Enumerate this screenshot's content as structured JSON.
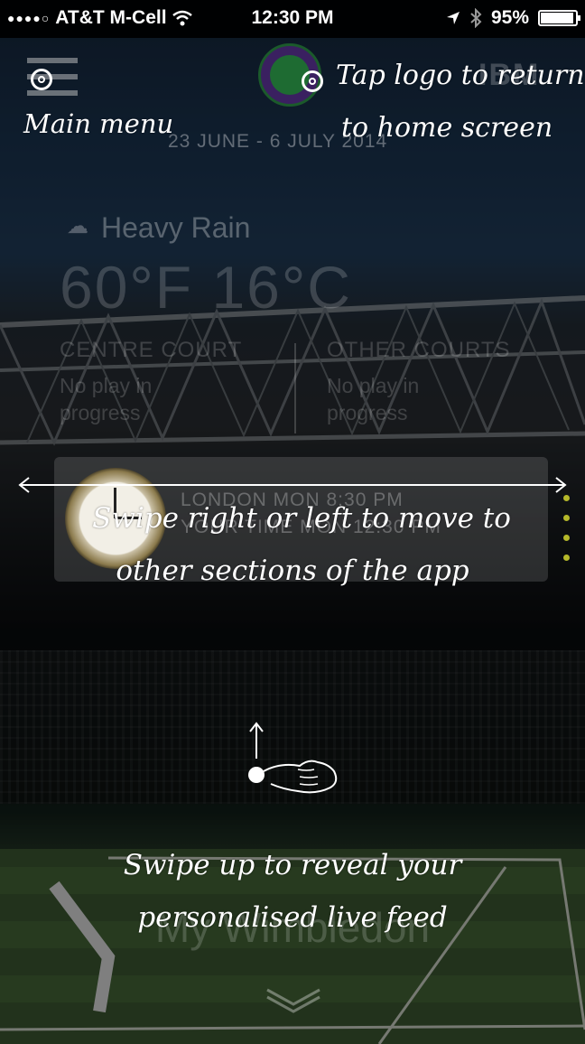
{
  "status_bar": {
    "carrier": "AT&T M-Cell",
    "time": "12:30 PM",
    "battery": "95%",
    "battery_fraction": 0.95,
    "signal_dots": "●●●●○"
  },
  "header": {
    "logo_name": "wimbledon-logo",
    "sponsor": "IBM",
    "dates": "23 JUNE - 6 JULY 2014"
  },
  "weather": {
    "condition": "Heavy Rain",
    "temperature": "60°F 16°C",
    "icon": "cloud-rain-icon"
  },
  "courts": {
    "centre": {
      "title": "CENTRE COURT",
      "status": "No play in progress"
    },
    "other": {
      "title": "OTHER COURTS",
      "status": "No play in progress"
    }
  },
  "time_panel": {
    "london": "LONDON  MON 8:30 PM",
    "local": "YOUR TIME  MON 12:30 PM"
  },
  "feed": {
    "title": "My Wimbledon"
  },
  "annotations": {
    "menu": "Main menu",
    "logo_line1": "Tap logo to return",
    "logo_line2": "to home screen",
    "swipe_line1": "Swipe right or left to move to",
    "swipe_line2": "other sections of the app",
    "up_line1": "Swipe up to reveal your",
    "up_line2": "personalised live feed"
  },
  "colors": {
    "accent_dots": "#b5b82a",
    "logo_purple": "#3a2060",
    "logo_green": "#1e6b32"
  }
}
